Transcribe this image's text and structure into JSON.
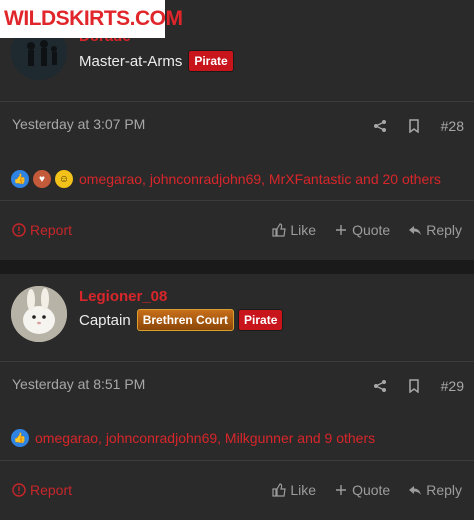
{
  "watermark": {
    "text": "WILDSKIRTS.COM"
  },
  "posts": [
    {
      "username": "Dorade",
      "user_title": "Master-at-Arms",
      "banners": [
        "Pirate"
      ],
      "date": "Yesterday at 3:07 PM",
      "post_number": "#28",
      "reactions_text": "omegarao, johnconradjohn69, MrXFantastic and 20 others",
      "reaction_icons": [
        "like-icon",
        "love-icon",
        "wow-icon"
      ],
      "footer": {
        "report": "Report",
        "like": "Like",
        "quote": "Quote",
        "reply": "Reply"
      }
    },
    {
      "username": "Legioner_08",
      "user_title": "Captain",
      "banners": [
        "Brethren Court",
        "Pirate"
      ],
      "date": "Yesterday at 8:51 PM",
      "post_number": "#29",
      "reactions_text": "omegarao, johnconradjohn69, Milkgunner and 9 others",
      "reaction_icons": [
        "like-icon"
      ],
      "footer": {
        "report": "Report",
        "like": "Like",
        "quote": "Quote",
        "reply": "Reply"
      }
    }
  ],
  "colors": {
    "accent_red": "#d8262a",
    "background": "#2a2a2a",
    "banner_red": "#c8141b",
    "banner_orange": "#c86f1a"
  }
}
